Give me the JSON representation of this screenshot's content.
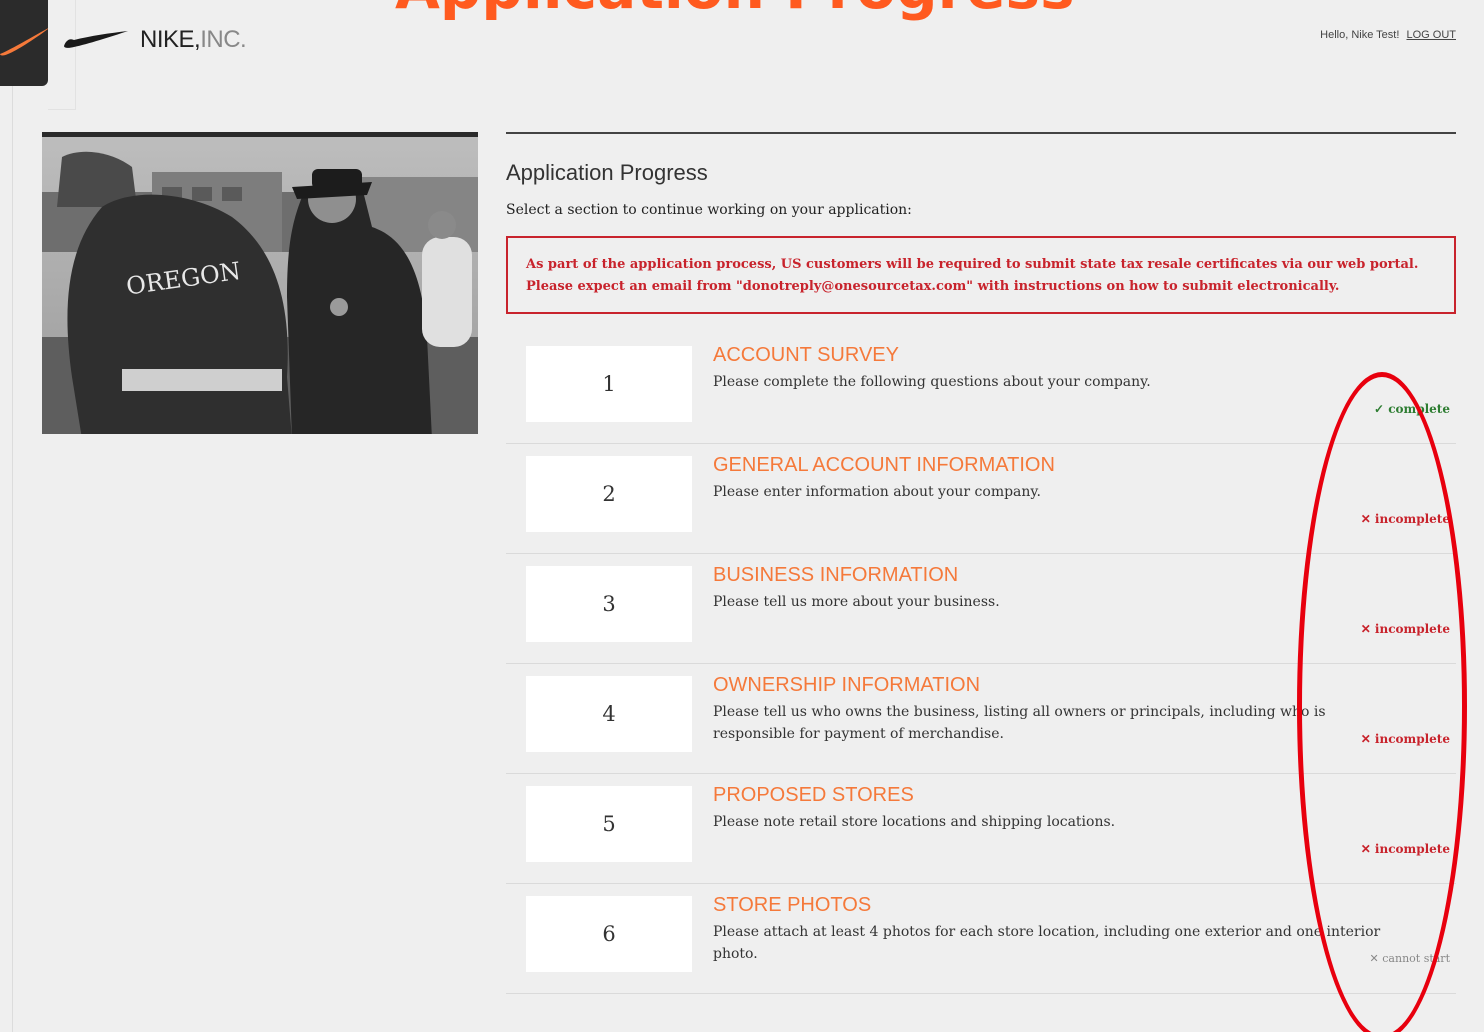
{
  "overlay": {
    "title": "Application Progress"
  },
  "header": {
    "brand_name": "NIKE,",
    "brand_suffix": "INC.",
    "greeting": "Hello, Nike Test!",
    "logout_label": "LOG OUT"
  },
  "hero": {
    "jacket_text": "OREGON"
  },
  "main": {
    "heading": "Application Progress",
    "instructions": "Select a section to continue working on your application:",
    "alert": "As part of the application process, US customers will be required to submit state tax resale certificates via our web portal. Please expect an email from \"donotreply@onesourcetax.com\" with instructions on how to submit electronically."
  },
  "sections": [
    {
      "number": "1",
      "title": "ACCOUNT SURVEY",
      "description": "Please complete the following questions about your company.",
      "status": "✓ complete",
      "status_type": "complete"
    },
    {
      "number": "2",
      "title": "GENERAL ACCOUNT INFORMATION",
      "description": "Please enter information about your company.",
      "status": "✕ incomplete",
      "status_type": "incomplete"
    },
    {
      "number": "3",
      "title": "BUSINESS INFORMATION",
      "description": "Please tell us more about your business.",
      "status": "✕ incomplete",
      "status_type": "incomplete"
    },
    {
      "number": "4",
      "title": "OWNERSHIP INFORMATION",
      "description": "Please tell us who owns the business, listing all owners or principals, including who is responsible for payment of merchandise.",
      "status": "✕ incomplete",
      "status_type": "incomplete"
    },
    {
      "number": "5",
      "title": "PROPOSED STORES",
      "description": "Please note retail store locations and shipping locations.",
      "status": "✕ incomplete",
      "status_type": "incomplete"
    },
    {
      "number": "6",
      "title": "STORE PHOTOS",
      "description": "Please attach at least 4 photos for each store location, including one exterior and one interior photo.",
      "status": "✕ cannot start",
      "status_type": "cannot"
    }
  ],
  "colors": {
    "accent": "#f5793a",
    "alert": "#c8232c",
    "complete": "#2e7d32",
    "annotation": "#e8000e"
  }
}
